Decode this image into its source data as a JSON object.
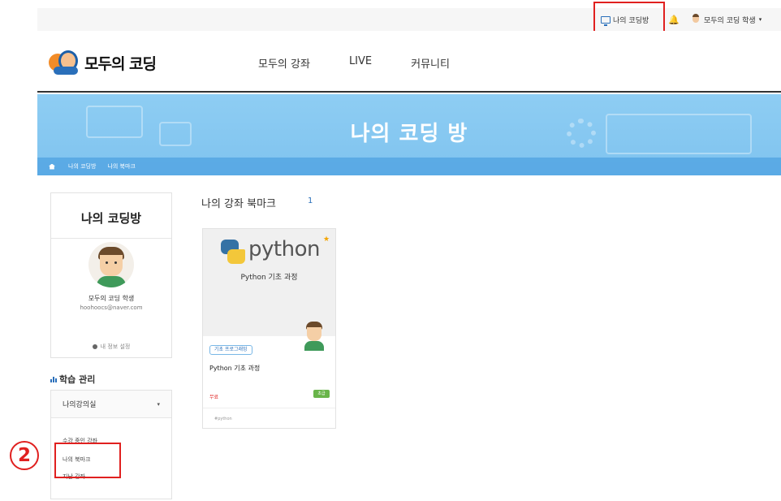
{
  "topbar": {
    "my_coding": "나의 코딩방",
    "bell_icon": "bell-icon",
    "user_name": "모두의 코딩 학생",
    "caret": "▾"
  },
  "header": {
    "logo_text": "모두의 코딩",
    "nav": [
      "모두의 강좌",
      "LIVE",
      "커뮤니티"
    ]
  },
  "banner": {
    "title": "나의 코딩 방",
    "breadcrumb": [
      "나의 코딩방",
      "나의 북마크"
    ]
  },
  "profile": {
    "title": "나의 코딩방",
    "name": "모두의 코딩 학생",
    "email": "hoohoocs@naver.com",
    "settings": "내 정보 설정"
  },
  "learning": {
    "title": "학습 관리",
    "dropdown_value": "나의강의실",
    "dropdown_caret": "▾",
    "items": [
      "수강 중인 강좌",
      "나의 북마크",
      "지난 강좌"
    ]
  },
  "main": {
    "section_title": "나의 강좌 북마크",
    "count": "1"
  },
  "course": {
    "brand_word": "python",
    "thumb_title": "Python 기초 과정",
    "tag": "기초 프로그래밍",
    "title": "Python 기초 과정",
    "price": "무료",
    "badge": "초급",
    "footer": "#python"
  },
  "annotation": {
    "marker": "②"
  },
  "colors": {
    "accent": "#2a6fba",
    "banner": "#8ecdf3",
    "highlight": "#e0201f",
    "badge": "#69b54a"
  }
}
